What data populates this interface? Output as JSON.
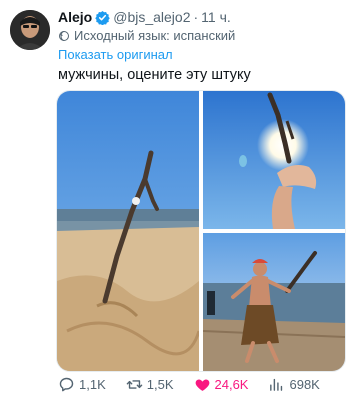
{
  "tweet": {
    "author_name": "Alejo",
    "handle": "@bjs_alejo2",
    "time": "11 ч.",
    "source_language": "Исходный язык: испанский",
    "show_original": "Показать оригинал",
    "text": "мужчины, оцените эту штуку"
  },
  "icons": {
    "verified": "verified-badge-icon",
    "globe": "translate-icon",
    "reply": "reply-icon",
    "retweet": "retweet-icon",
    "like": "heart-icon",
    "views": "views-icon"
  },
  "colors": {
    "accent": "#1d9bf0",
    "like": "#f91880",
    "secondary_text": "#536471"
  },
  "stats": {
    "replies": "1,1K",
    "retweets": "1,5K",
    "likes": "24,6K",
    "views": "698K"
  }
}
